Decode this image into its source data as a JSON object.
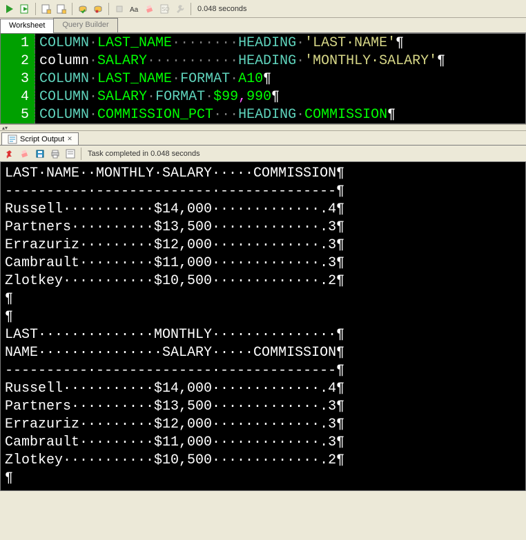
{
  "toolbar": {
    "time_text": "0.048 seconds"
  },
  "tabs": {
    "worksheet": "Worksheet",
    "query_builder": "Query Builder"
  },
  "editor_lines": [
    {
      "n": "1",
      "segments": [
        [
          "kw-teal",
          "COLUMN"
        ],
        [
          "dim",
          "·"
        ],
        [
          "kw-green",
          "LAST_NAME"
        ],
        [
          "dim",
          "········"
        ],
        [
          "kw-teal",
          "HEADING"
        ],
        [
          "dim",
          "·"
        ],
        [
          "kw-yellow",
          "'LAST·NAME'"
        ],
        [
          "kw-white",
          "¶"
        ]
      ]
    },
    {
      "n": "2",
      "segments": [
        [
          "kw-white",
          "column"
        ],
        [
          "dim",
          "·"
        ],
        [
          "kw-green",
          "SALARY"
        ],
        [
          "dim",
          "···········"
        ],
        [
          "kw-teal",
          "HEADING"
        ],
        [
          "dim",
          "·"
        ],
        [
          "kw-yellow",
          "'MONTHLY·SALARY'"
        ],
        [
          "kw-white",
          "¶"
        ]
      ]
    },
    {
      "n": "3",
      "segments": [
        [
          "kw-teal",
          "COLUMN"
        ],
        [
          "dim",
          "·"
        ],
        [
          "kw-green",
          "LAST_NAME"
        ],
        [
          "dim",
          "·"
        ],
        [
          "kw-teal",
          "FORMAT"
        ],
        [
          "dim",
          "·"
        ],
        [
          "kw-green",
          "A10"
        ],
        [
          "kw-white",
          "¶"
        ]
      ]
    },
    {
      "n": "4",
      "segments": [
        [
          "kw-teal",
          "COLUMN"
        ],
        [
          "dim",
          "·"
        ],
        [
          "kw-green",
          "SALARY"
        ],
        [
          "dim",
          "·"
        ],
        [
          "kw-teal",
          "FORMAT"
        ],
        [
          "dim",
          "·"
        ],
        [
          "kw-green",
          "$99"
        ],
        [
          "kw-pink",
          ","
        ],
        [
          "kw-green",
          "990"
        ],
        [
          "kw-white",
          "¶"
        ]
      ]
    },
    {
      "n": "5",
      "segments": [
        [
          "kw-teal",
          "COLUMN"
        ],
        [
          "dim",
          "·"
        ],
        [
          "kw-green",
          "COMMISSION_PCT"
        ],
        [
          "dim",
          "···"
        ],
        [
          "kw-teal",
          "HEADING"
        ],
        [
          "dim",
          "·"
        ],
        [
          "kw-green",
          "COMMISSION"
        ],
        [
          "kw-white",
          "¶"
        ]
      ]
    }
  ],
  "output_tab": {
    "label": "Script Output"
  },
  "output_toolbar": {
    "status": "Task completed in 0.048 seconds"
  },
  "output_lines": [
    "LAST·NAME··MONTHLY·SALARY·····COMMISSION¶",
    "----------·--------------·--------------¶",
    "Russell···········$14,000·············.4¶",
    "Partners··········$13,500·············.3¶",
    "Errazuriz·········$12,000·············.3¶",
    "Cambrault·········$11,000·············.3¶",
    "Zlotkey···········$10,500·············.2¶",
    "¶",
    "¶",
    "LAST··············MONTHLY···············¶",
    "NAME···············SALARY·····COMMISSION¶",
    "----------·--------------·--------------¶",
    "Russell···········$14,000·············.4¶",
    "Partners··········$13,500·············.3¶",
    "Errazuriz·········$12,000·············.3¶",
    "Cambrault·········$11,000·············.3¶",
    "Zlotkey···········$10,500·············.2¶",
    "¶"
  ]
}
